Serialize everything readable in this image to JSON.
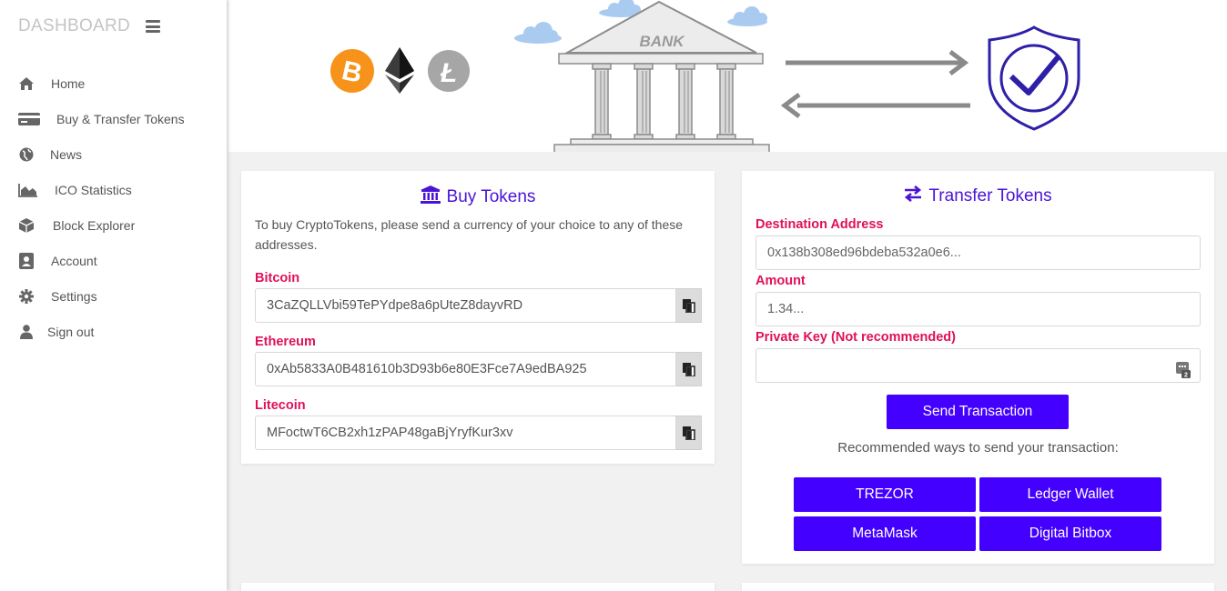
{
  "sidebar": {
    "brand": "DASHBOARD",
    "items": [
      {
        "label": "Home",
        "icon": "home-icon"
      },
      {
        "label": "Buy & Transfer Tokens",
        "icon": "credit-card-icon"
      },
      {
        "label": "News",
        "icon": "globe-icon"
      },
      {
        "label": "ICO Statistics",
        "icon": "area-chart-icon"
      },
      {
        "label": "Block Explorer",
        "icon": "cube-icon"
      },
      {
        "label": "Account",
        "icon": "user-badge-icon"
      },
      {
        "label": "Settings",
        "icon": "gear-icon"
      },
      {
        "label": "Sign out",
        "icon": "user-icon"
      }
    ]
  },
  "banner": {
    "bank_label": "BANK",
    "colors": {
      "bitcoin": "#f7931a",
      "ethereum": "#3c3c3d",
      "litecoin": "#a6a6a6",
      "shield": "#2e1fa8",
      "arrows": "#8a8a8a",
      "clouds": "#a9cbef"
    }
  },
  "buy": {
    "title": "Buy Tokens",
    "description": "To buy CryptoTokens, please send a currency of your choice to any of these addresses.",
    "fields": [
      {
        "label": "Bitcoin",
        "value": "3CaZQLLVbi59TePYdpe8a6pUteZ8dayvRD"
      },
      {
        "label": "Ethereum",
        "value": "0xAb5833A0B481610b3D93b6e80E3Fce7A9edBA925"
      },
      {
        "label": "Litecoin",
        "value": "MFoctwT6CB2xh1zPAP48gaBjYryfKur3xv"
      }
    ]
  },
  "transfer": {
    "title": "Transfer Tokens",
    "destination_label": "Destination Address",
    "destination_placeholder": "0x138b308ed96bdeba532a0e6...",
    "amount_label": "Amount",
    "amount_placeholder": "1.34...",
    "private_key_label": "Private Key (Not recommended)",
    "private_key_value": "",
    "send_button": "Send Transaction",
    "recommended_text": "Recommended ways to send your transaction:",
    "wallets": [
      "TREZOR",
      "Ledger Wallet",
      "MetaMask",
      "Digital Bitbox"
    ]
  },
  "colors": {
    "accent": "#4400ff",
    "title": "#4a14d6",
    "label": "#e0105a"
  }
}
